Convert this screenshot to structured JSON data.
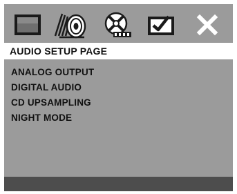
{
  "tabs": [
    {
      "icon": "general-setup-icon"
    },
    {
      "icon": "audio-setup-icon"
    },
    {
      "icon": "video-setup-icon"
    },
    {
      "icon": "preference-setup-icon"
    },
    {
      "icon": "exit-icon"
    }
  ],
  "page_title": "AUDIO SETUP PAGE",
  "menu": {
    "items": [
      {
        "label": "ANALOG OUTPUT"
      },
      {
        "label": "DIGITAL AUDIO"
      },
      {
        "label": "CD UPSAMPLING"
      },
      {
        "label": "NIGHT MODE"
      }
    ]
  },
  "colors": {
    "background": "#9b9b9b",
    "title_bar": "#ffffff",
    "footer_bar": "#4d4d4d",
    "icon_dark": "#1a1a1a",
    "icon_light": "#ffffff"
  }
}
